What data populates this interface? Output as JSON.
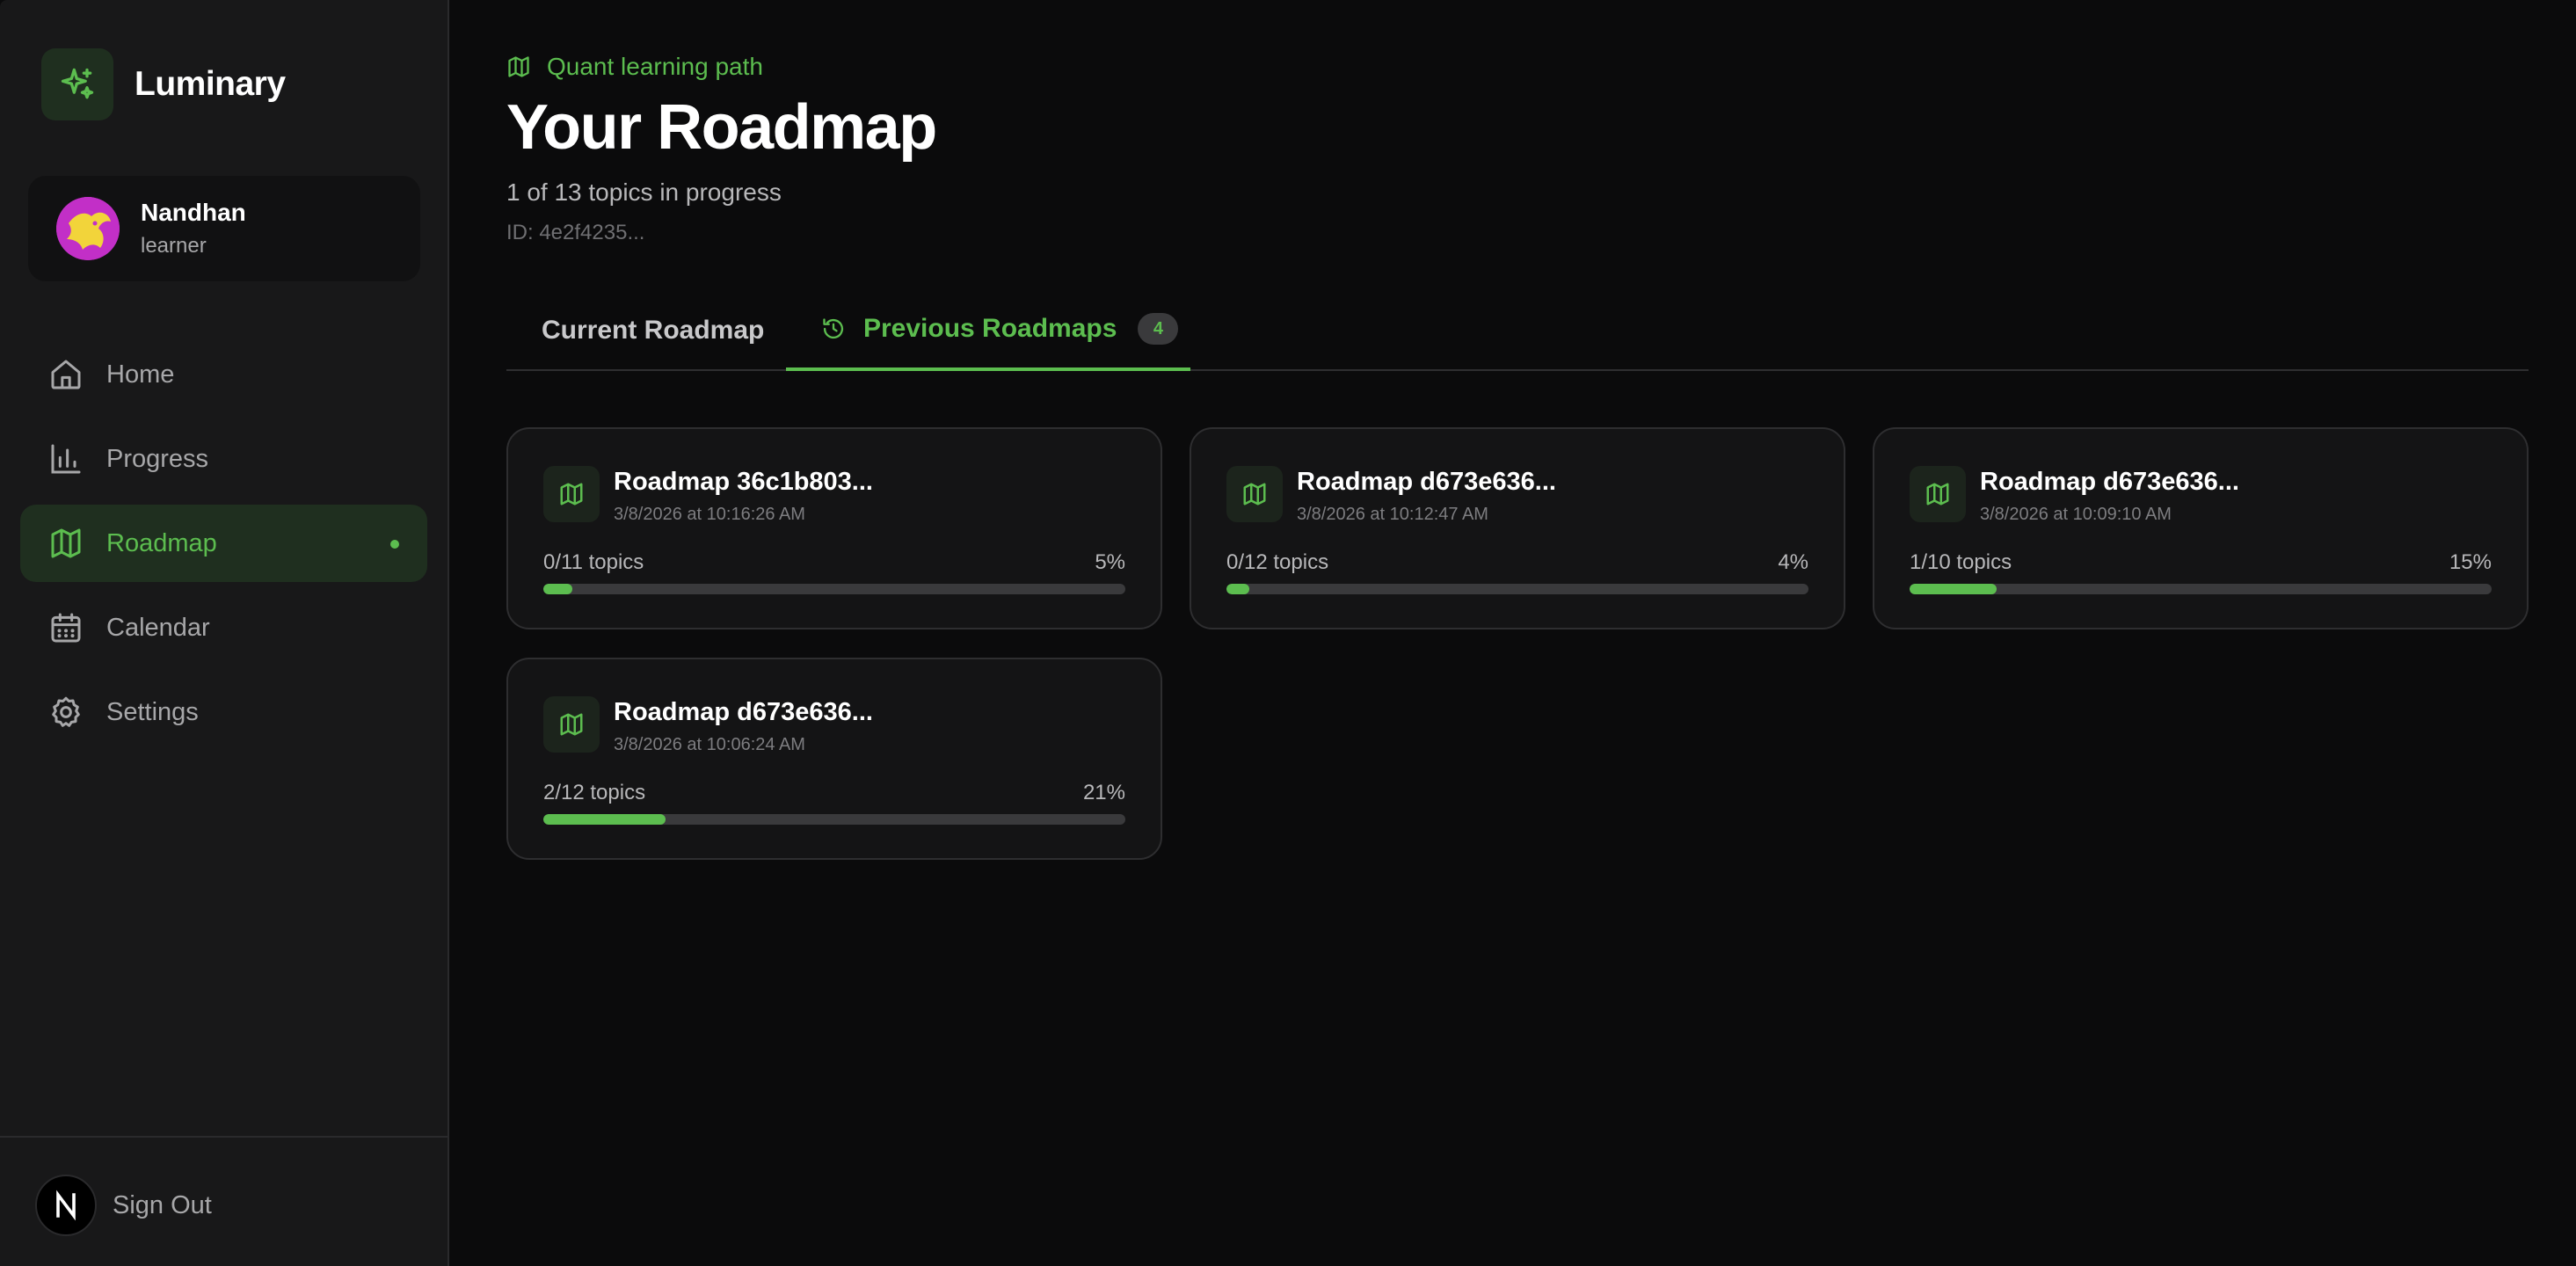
{
  "brand": {
    "name": "Luminary"
  },
  "user": {
    "name": "Nandhan",
    "role": "learner"
  },
  "nav": [
    {
      "label": "Home",
      "icon": "home-icon",
      "active": false
    },
    {
      "label": "Progress",
      "icon": "bar-chart-icon",
      "active": false
    },
    {
      "label": "Roadmap",
      "icon": "map-icon",
      "active": true
    },
    {
      "label": "Calendar",
      "icon": "calendar-icon",
      "active": false
    },
    {
      "label": "Settings",
      "icon": "gear-icon",
      "active": false
    }
  ],
  "footer": {
    "signout_label": "Sign Out",
    "badge_letter": "N"
  },
  "header": {
    "eyebrow": "Quant learning path",
    "title": "Your Roadmap",
    "subtitle": "1 of 13 topics in progress",
    "id": "ID: 4e2f4235..."
  },
  "tabs": {
    "current_label": "Current Roadmap",
    "previous_label": "Previous Roadmaps",
    "previous_count": "4",
    "active": "previous"
  },
  "roadmaps": [
    {
      "title": "Roadmap 36c1b803...",
      "date": "3/8/2026 at 10:16:26 AM",
      "topics": "0/11 topics",
      "percent_label": "5%",
      "percent": 5
    },
    {
      "title": "Roadmap d673e636...",
      "date": "3/8/2026 at 10:12:47 AM",
      "topics": "0/12 topics",
      "percent_label": "4%",
      "percent": 4
    },
    {
      "title": "Roadmap d673e636...",
      "date": "3/8/2026 at 10:09:10 AM",
      "topics": "1/10 topics",
      "percent_label": "15%",
      "percent": 15
    },
    {
      "title": "Roadmap d673e636...",
      "date": "3/8/2026 at 10:06:24 AM",
      "topics": "2/12 topics",
      "percent_label": "21%",
      "percent": 21
    }
  ],
  "colors": {
    "accent": "#5cbd4f",
    "background": "#0b0b0c",
    "sidebar": "#181819",
    "card": "#141415"
  }
}
